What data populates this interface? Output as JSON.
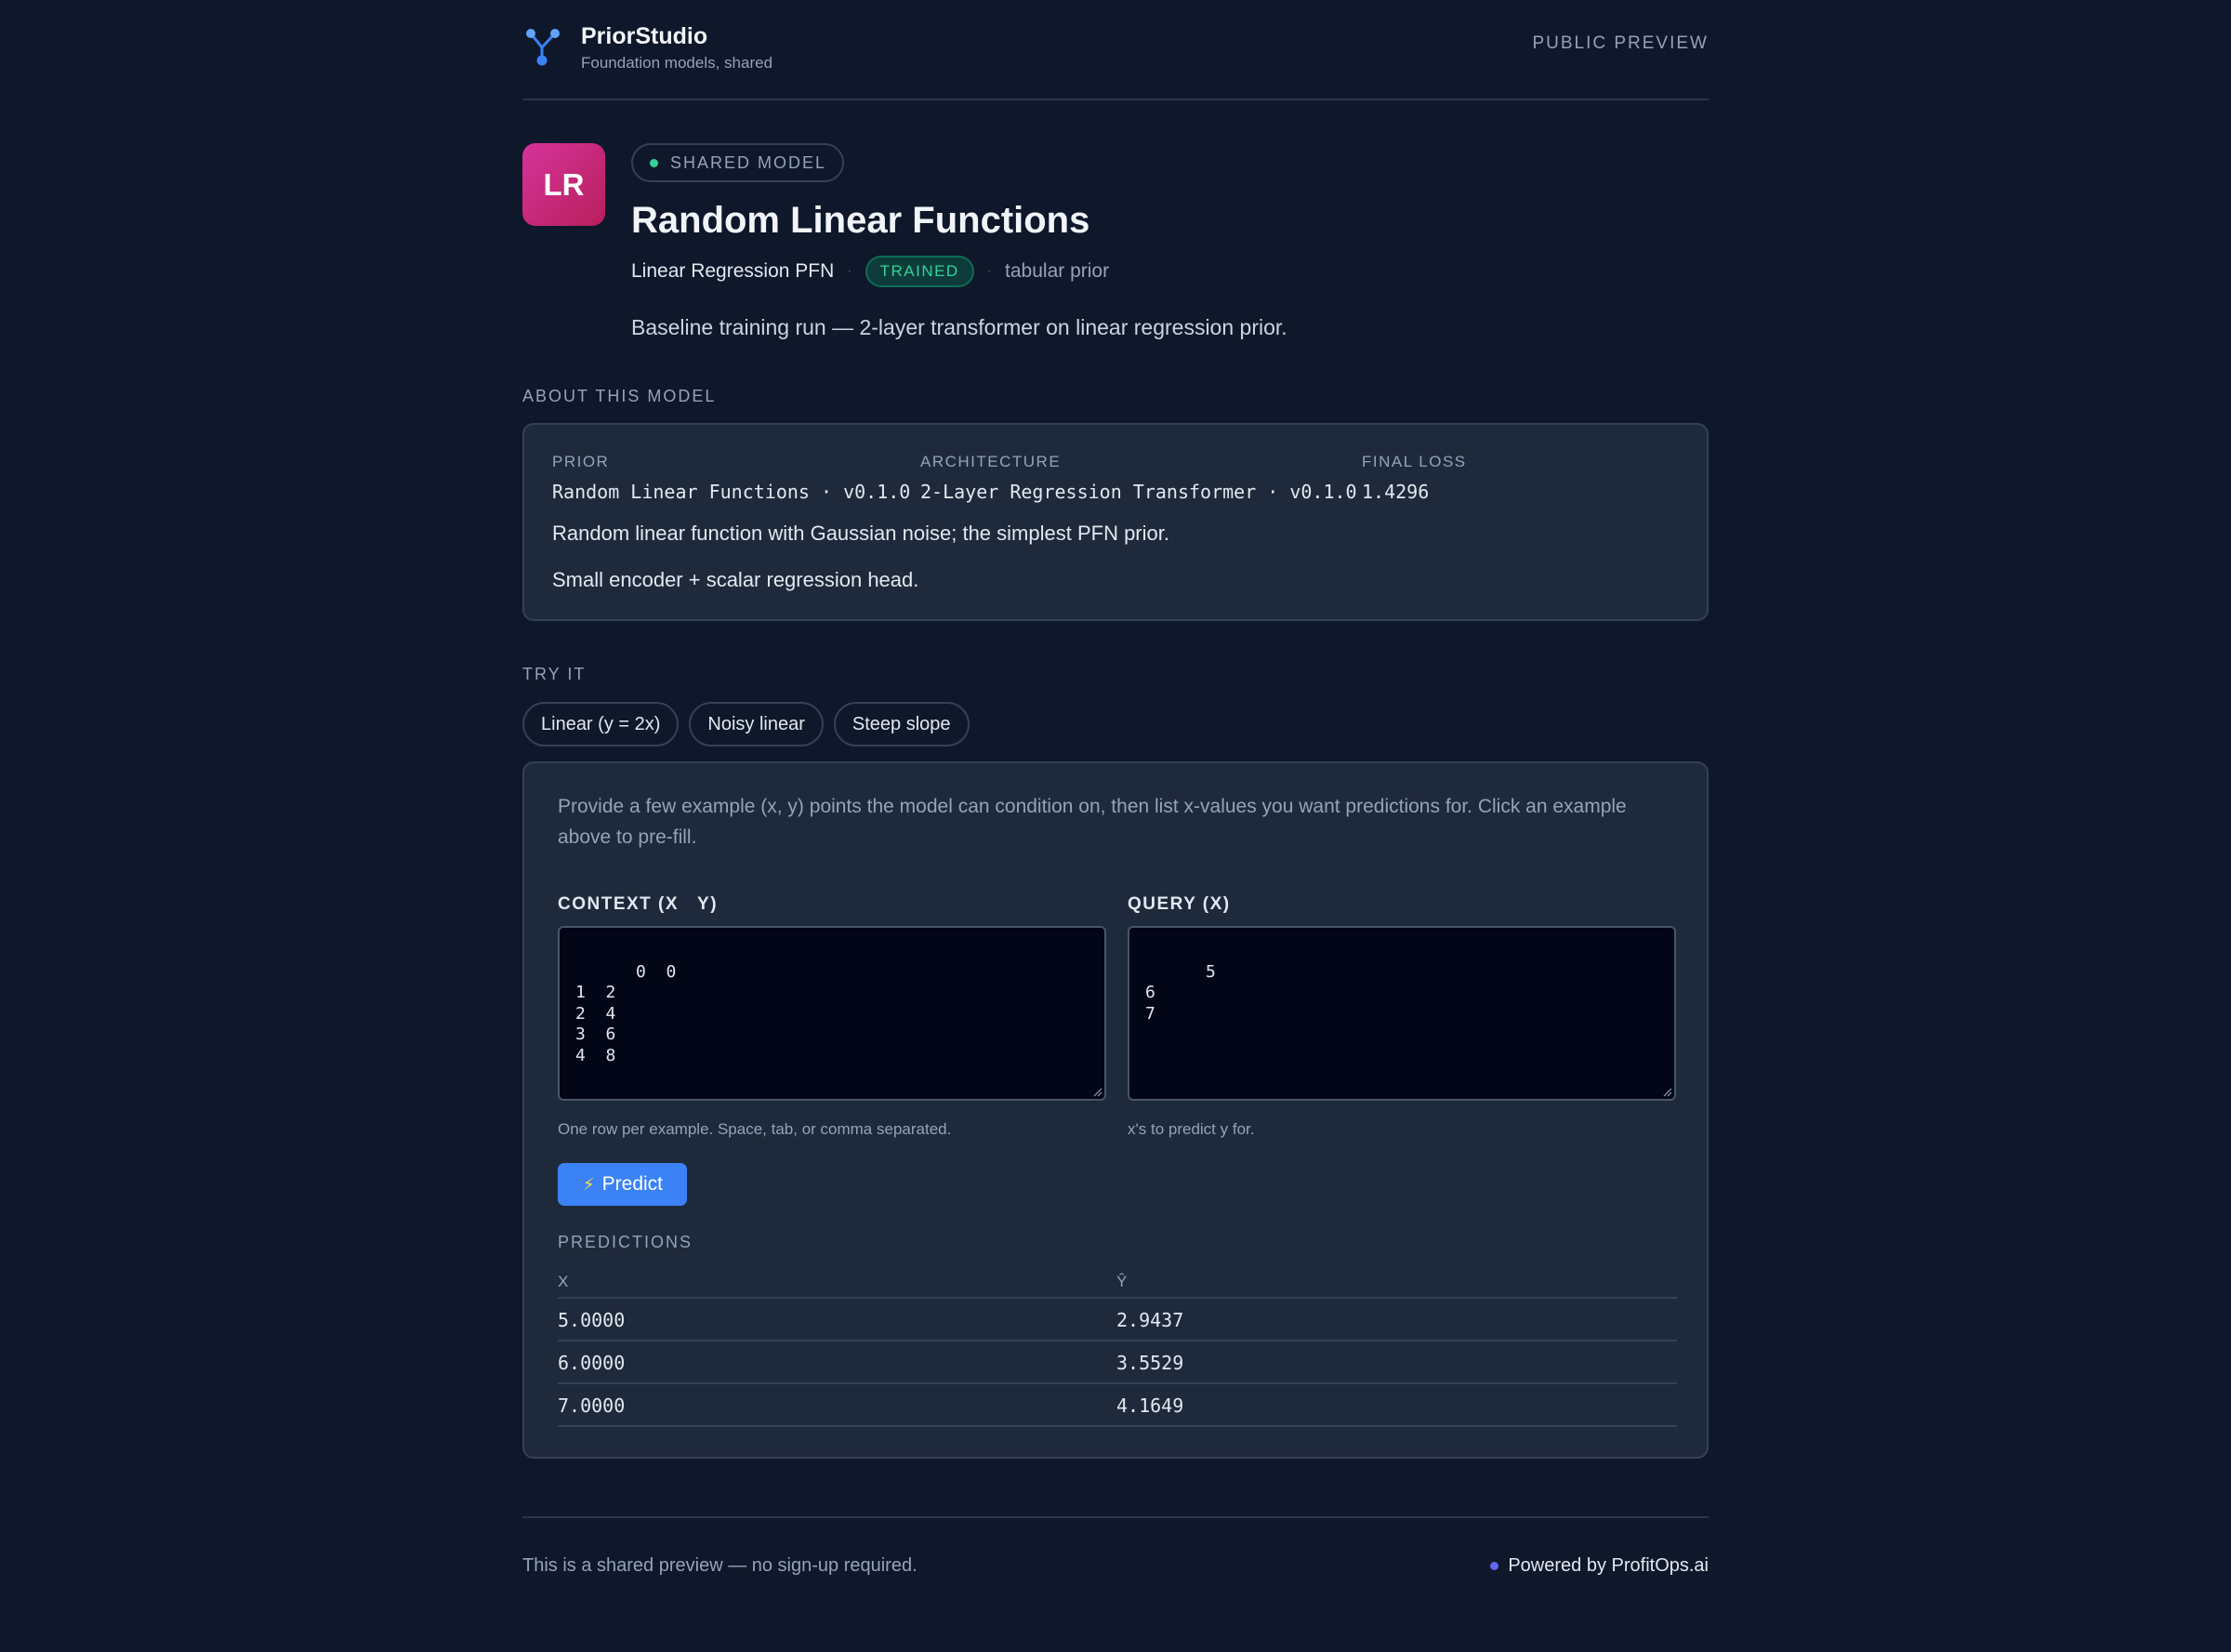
{
  "header": {
    "app_name": "PriorStudio",
    "tagline": "Foundation models, shared",
    "mode_label": "PUBLIC PREVIEW",
    "logo_icon": "network-fork-icon"
  },
  "model": {
    "avatar_initials": "LR",
    "shared_label": "SHARED MODEL",
    "title": "Random Linear Functions",
    "subtitle": "Linear Regression PFN",
    "separator": "·",
    "status": "TRAINED",
    "category": "tabular prior",
    "description": "Baseline training run — 2-layer transformer on linear regression prior."
  },
  "about": {
    "section_label": "ABOUT THIS MODEL",
    "prior_key": "PRIOR",
    "prior_value": "Random Linear Functions · v0.1.0",
    "architecture_key": "ARCHITECTURE",
    "architecture_value": "2-Layer Regression Transformer · v0.1.0",
    "loss_key": "FINAL LOSS",
    "loss_value": "1.4296",
    "prior_description": "Random linear function with Gaussian noise; the simplest PFN prior.",
    "architecture_description": "Small encoder + scalar regression head."
  },
  "try_it": {
    "section_label": "TRY IT",
    "examples": [
      "Linear (y = 2x)",
      "Noisy linear",
      "Steep slope"
    ],
    "intro": "Provide a few example (x, y) points the model can condition on, then list x-values you want predictions for. Click an example above to pre-fill.",
    "context_label": "CONTEXT (X   Y)",
    "context_value": "0  0\n1  2\n2  4\n3  6\n4  8",
    "context_hint": "One row per example. Space, tab, or comma separated.",
    "query_label": "QUERY (X)",
    "query_value": "5\n6\n7",
    "query_hint": "x's to predict y for.",
    "predict_label": "Predict",
    "predict_icon": "lightning-bolt-icon",
    "predictions_label": "PREDICTIONS",
    "col_x": "X",
    "col_y": "Ŷ",
    "rows": [
      {
        "x": "5.0000",
        "y": "2.9437"
      },
      {
        "x": "6.0000",
        "y": "3.5529"
      },
      {
        "x": "7.0000",
        "y": "4.1649"
      }
    ]
  },
  "footer": {
    "note": "This is a shared preview — no sign-up required.",
    "powered_by": "Powered by ProfitOps.ai"
  },
  "colors": {
    "background": "#0f172a",
    "card": "#1e293b",
    "accent_blue": "#3b82f6",
    "status_green": "#34d399",
    "avatar_pink": "#d6339a"
  }
}
